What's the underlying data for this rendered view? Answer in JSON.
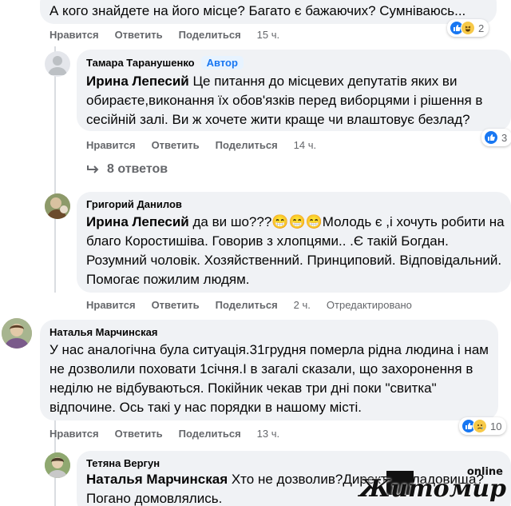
{
  "actions": {
    "like": "Нравится",
    "reply": "Ответить",
    "share": "Поделиться"
  },
  "comments": [
    {
      "text": "А кого знайдете на його місце? Багато є бажаючих? Сумніваюсь...",
      "time": "15 ч.",
      "reaction_count": "2"
    },
    {
      "author": "Тамара Таранушенко",
      "author_badge": "Автор",
      "mention": "Ирина Лепесий",
      "text": " Це питання до місцевих депутатів яких ви обираєте,виконання їх обов'язків перед виборцями і рішення в сесійній залі. Ви ж хочете жити краще чи влаштовує безлад?",
      "time": "14 ч.",
      "reaction_count": "3",
      "replies_label": "8 ответов"
    },
    {
      "author": "Григорий Данилов",
      "mention": "Ирина Лепесий",
      "text_a": " да ви шо???😁😁😁",
      "text_b": "Молодь є ,і хочуть робити на благо Коростишіва. Говорив з хлопцями.. .Є такій Богдан. Розумний чоловік. Хозяйственний. Принциповий. Відповідальний. Помогає пожилим людям.",
      "time": "2 ч.",
      "edited": "Отредактировано"
    },
    {
      "author": "Наталья Марчинская",
      "text": "У нас аналогічна була ситуація.31грудня померла рідна людина і нам не дозволили поховати 1січня.І в загалі сказали, що захоронення в неділю не відбуваються. Покійник чекав три дні поки \"свитка\" відпочине. Ось такі у нас порядки в нашому місті.",
      "time": "13 ч.",
      "reaction_count": "10"
    },
    {
      "author": "Тетяна Вергун",
      "mention": "Наталья Марчинская",
      "text_a": " Хто не дозволив?Директор кладовища?",
      "text_b": "Погано домовлялись."
    }
  ],
  "watermark": {
    "prefix": "online",
    "name": "Житомир"
  },
  "colors": {
    "like_blue": "#1877f2",
    "haha_yellow": "#f7c948",
    "sad_yellow": "#f7c948",
    "secondary_text": "#65676b",
    "bubble_bg": "#f0f2f5"
  }
}
